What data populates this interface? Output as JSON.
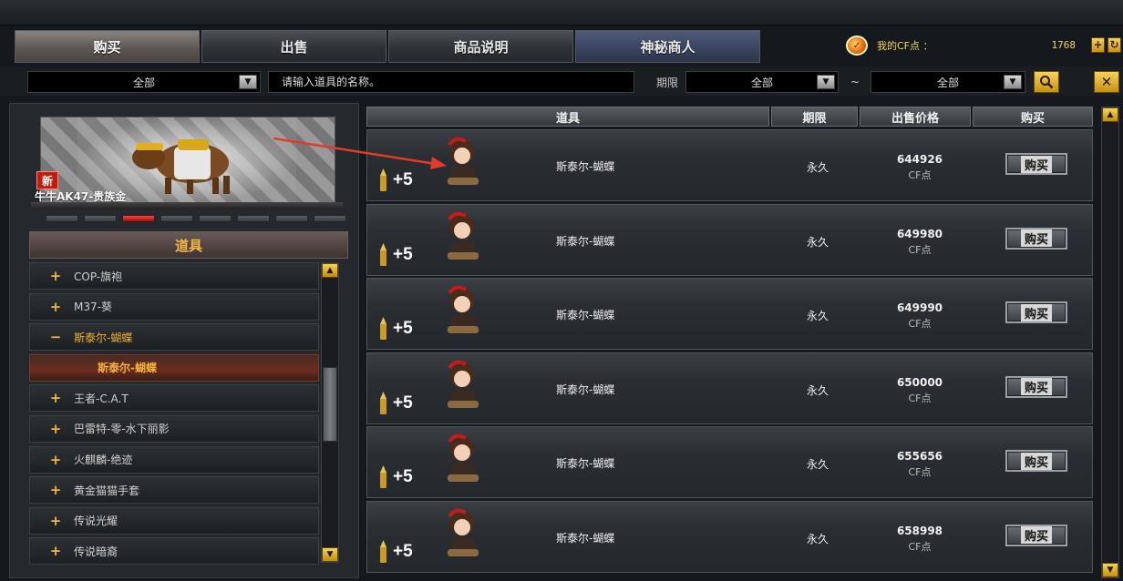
{
  "tabs": [
    {
      "label": "购买",
      "active": true
    },
    {
      "label": "出售",
      "active": false
    },
    {
      "label": "商品说明",
      "active": false
    },
    {
      "label": "神秘商人",
      "active": false
    }
  ],
  "cf_points": {
    "label": "我的CF点 ：",
    "value": "1768"
  },
  "filter": {
    "category": "全部",
    "search_placeholder": "请输入道具的名称。",
    "period_label": "期限",
    "period_from": "全部",
    "tilde": "~",
    "period_to": "全部"
  },
  "banner": {
    "badge": "新",
    "caption": "牛牛AK47-贵族金"
  },
  "category_header": "道具",
  "tree": [
    {
      "sign": "+",
      "label": "COP-旗袍"
    },
    {
      "sign": "+",
      "label": "M37-葵"
    },
    {
      "sign": "−",
      "label": "斯泰尔-蝴蝶",
      "open": true
    },
    {
      "sign": "",
      "label": "斯泰尔-蝴蝶",
      "child": true
    },
    {
      "sign": "+",
      "label": "王者-C.A.T"
    },
    {
      "sign": "+",
      "label": "巴雷特-零-水下丽影"
    },
    {
      "sign": "+",
      "label": "火麒麟-绝迹"
    },
    {
      "sign": "+",
      "label": "黄金猫猫手套"
    },
    {
      "sign": "+",
      "label": "传说光耀"
    },
    {
      "sign": "+",
      "label": "传说暗裔"
    }
  ],
  "table": {
    "headers": {
      "item": "道具",
      "period": "期限",
      "price": "出售价格",
      "buy": "购买"
    },
    "rows": [
      {
        "plus": "+5",
        "name": "斯泰尔-蝴蝶",
        "period": "永久",
        "price": "644926",
        "unit": "CF点",
        "buy": "购买"
      },
      {
        "plus": "+5",
        "name": "斯泰尔-蝴蝶",
        "period": "永久",
        "price": "649980",
        "unit": "CF点",
        "buy": "购买"
      },
      {
        "plus": "+5",
        "name": "斯泰尔-蝴蝶",
        "period": "永久",
        "price": "649990",
        "unit": "CF点",
        "buy": "购买"
      },
      {
        "plus": "+5",
        "name": "斯泰尔-蝴蝶",
        "period": "永久",
        "price": "650000",
        "unit": "CF点",
        "buy": "购买"
      },
      {
        "plus": "+5",
        "name": "斯泰尔-蝴蝶",
        "period": "永久",
        "price": "655656",
        "unit": "CF点",
        "buy": "购买"
      },
      {
        "plus": "+5",
        "name": "斯泰尔-蝴蝶",
        "period": "永久",
        "price": "658998",
        "unit": "CF点",
        "buy": "购买"
      }
    ]
  },
  "colors": {
    "accent_gold": "#f2b53a",
    "annotation_arrow": "#e23b2e"
  }
}
